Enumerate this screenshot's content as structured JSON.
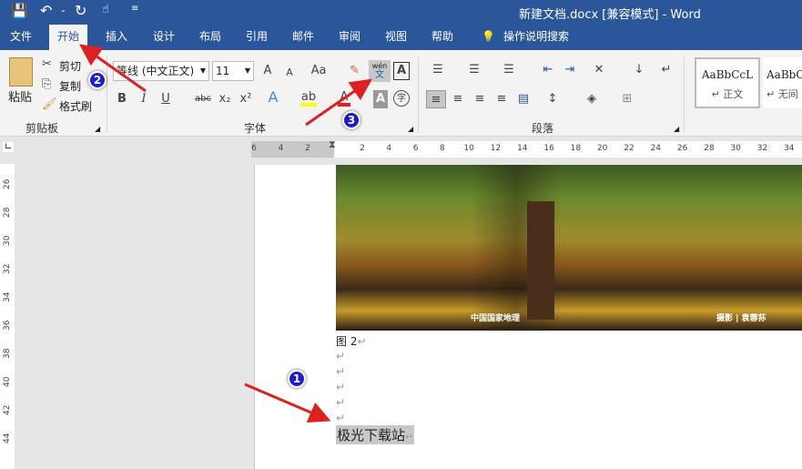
{
  "window": {
    "title": "新建文档.docx [兼容模式]  -  Word"
  },
  "quick_access": {
    "save": "save-icon",
    "undo": "undo-icon",
    "redo": "redo-icon",
    "touch": "touch-mode-icon",
    "customize": "customize-icon"
  },
  "tabs": [
    "文件",
    "开始",
    "插入",
    "设计",
    "布局",
    "引用",
    "邮件",
    "审阅",
    "视图",
    "帮助"
  ],
  "search_label": "操作说明搜索",
  "clipboard": {
    "paste": "粘贴",
    "cut": "剪切",
    "copy": "复制",
    "format_painter": "格式刷",
    "group": "剪贴板"
  },
  "font": {
    "name": "等线 (中文正文)",
    "size": "11",
    "group": "字体",
    "phonetic_top": "wén",
    "phonetic_bottom": "文",
    "change_case": "Aa",
    "grow": "A",
    "shrink": "A",
    "bold": "B",
    "italic": "I",
    "underline": "U",
    "strike": "abc",
    "sub": "x₂",
    "sup": "x²",
    "enclose": "字"
  },
  "paragraph": {
    "group": "段落"
  },
  "styles": [
    {
      "preview": "AaBbCcL",
      "name": "↵ 正文"
    },
    {
      "preview": "AaBbC",
      "name": "↵ 无间"
    }
  ],
  "ruler": {
    "h_left": [
      "6",
      "4",
      "2"
    ],
    "h_right": [
      "2",
      "4",
      "6",
      "8",
      "10",
      "12",
      "14",
      "16",
      "18",
      "20",
      "22",
      "24",
      "26",
      "28",
      "30",
      "32",
      "34"
    ],
    "v": [
      "26",
      "28",
      "30",
      "32",
      "34",
      "36",
      "38",
      "40",
      "42",
      "44"
    ]
  },
  "document": {
    "caption": "图 2",
    "caption_mark": "↵",
    "mark": "↵",
    "selected_text": "极光下载站",
    "photo_watermarks": [
      "中国国家地理",
      "摄影 | 袁蓉荪"
    ]
  },
  "annotations": [
    "1",
    "2",
    "3"
  ],
  "colors": {
    "brand": "#2b579a",
    "arrow": "#e02020",
    "badge": "#1d1dd0",
    "highlight": "#ffff00",
    "font_color": "#e02020"
  }
}
